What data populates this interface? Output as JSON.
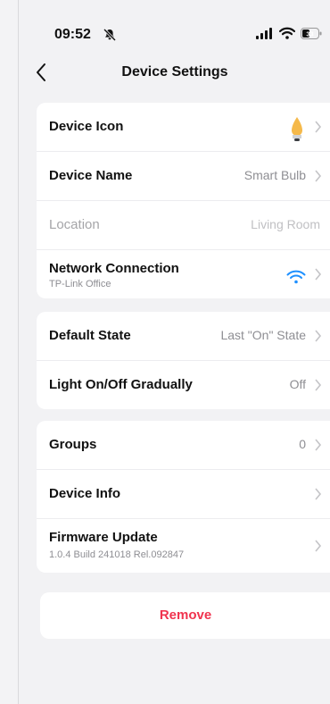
{
  "status_bar": {
    "time": "09:52",
    "battery": "33"
  },
  "nav": {
    "title": "Device Settings"
  },
  "section1": {
    "device_icon_label": "Device Icon",
    "device_name_label": "Device Name",
    "device_name_value": "Smart Bulb",
    "location_label": "Location",
    "location_value": "Living Room",
    "network_label": "Network Connection",
    "network_sub": "TP-Link Office"
  },
  "section2": {
    "default_state_label": "Default State",
    "default_state_value": "Last \"On\" State",
    "gradual_label": "Light On/Off Gradually",
    "gradual_value": "Off"
  },
  "section3": {
    "groups_label": "Groups",
    "groups_value": "0",
    "device_info_label": "Device Info",
    "firmware_label": "Firmware Update",
    "firmware_sub": "1.0.4 Build 241018 Rel.092847"
  },
  "remove_label": "Remove",
  "colors": {
    "accent_blue": "#1e90ff",
    "danger": "#f0334e",
    "bulb": "#f5b94a"
  },
  "icons": [
    "bell-slash-icon",
    "cellular-icon",
    "wifi-icon",
    "battery-icon",
    "back-chevron-icon",
    "bulb-icon",
    "chevron-right-icon"
  ]
}
